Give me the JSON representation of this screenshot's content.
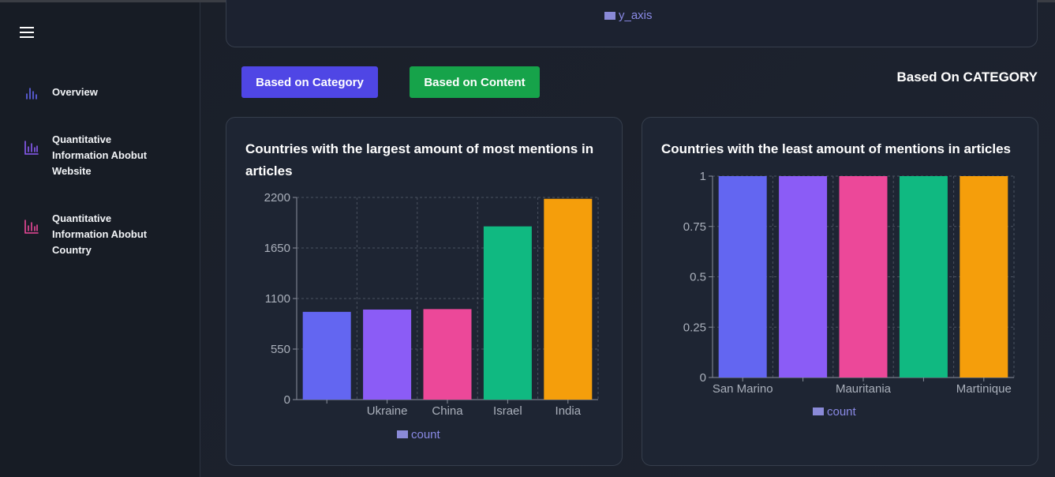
{
  "sidebar": {
    "items": [
      {
        "label": "Overview",
        "icon": "bar-chart-icon",
        "color": "#6366f1"
      },
      {
        "label": "Quantitative Information Abobut Website",
        "icon": "bar-chart-box-icon",
        "color": "#8b5cf6"
      },
      {
        "label": "Quantitative Information Abobut Country",
        "icon": "bar-chart-box-icon",
        "color": "#ec4899"
      }
    ]
  },
  "top_card": {
    "legend": "y_axis"
  },
  "buttons": {
    "category": "Based on Category",
    "content": "Based on Content"
  },
  "section_title": "Based On CATEGORY",
  "colors": [
    "#6366f1",
    "#8b5cf6",
    "#ec4899",
    "#10b981",
    "#f59e0b"
  ],
  "chart_data": [
    {
      "type": "bar",
      "title": "Countries with the largest amount of most mentions in articles",
      "categories": [
        "",
        "Ukraine",
        "China",
        "Israel",
        "India"
      ],
      "x_tick_labels": [
        "",
        "Ukraine",
        "China",
        "Israel",
        "India"
      ],
      "values": [
        955,
        980,
        985,
        1885,
        2185
      ],
      "y_ticks": [
        0,
        550,
        1100,
        1650,
        2200
      ],
      "ylim": [
        0,
        2200
      ],
      "legend": "count",
      "legend_position": "bottom"
    },
    {
      "type": "bar",
      "title": "Countries with the least amount of mentions in articles",
      "categories": [
        "San Marino",
        "",
        "Mauritania",
        "",
        "Martinique"
      ],
      "x_tick_labels": [
        "San Marino",
        "",
        "Mauritania",
        "",
        "Martinique"
      ],
      "values": [
        1,
        1,
        1,
        1,
        1
      ],
      "y_ticks": [
        0,
        0.25,
        0.5,
        0.75,
        1
      ],
      "ylim": [
        0,
        1
      ],
      "legend": "count",
      "legend_position": "bottom"
    }
  ]
}
